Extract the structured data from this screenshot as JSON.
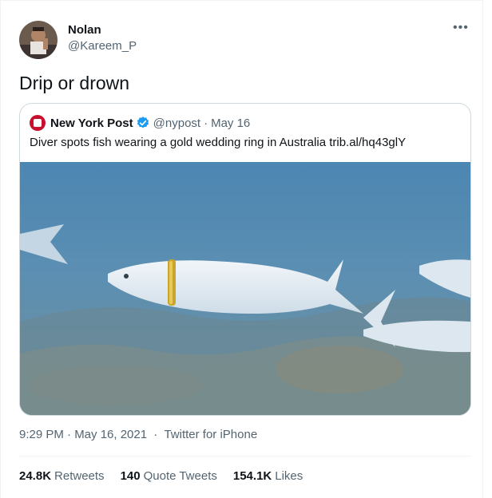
{
  "tweet": {
    "author_name": "Nolan",
    "author_handle": "@Kareem_P",
    "more_icon": "more-dots-icon",
    "text": "Drip or drown",
    "timestamp": "9:29 PM · May 16, 2021",
    "separator": "·",
    "source": "Twitter for iPhone"
  },
  "quoted": {
    "name": "New York Post",
    "handle": "@nypost",
    "dot": "·",
    "date": "May 16",
    "text": "Diver spots fish wearing a gold wedding ring in Australia trib.al/hq43glY",
    "verified_icon": "verified-badge-icon",
    "colors": {
      "logo": "#c8102e",
      "verified": "#1d9bf0"
    }
  },
  "stats": [
    {
      "count": "24.8K",
      "label": "Retweets"
    },
    {
      "count": "140",
      "label": "Quote Tweets"
    },
    {
      "count": "154.1K",
      "label": "Likes"
    }
  ],
  "colors": {
    "text": "#0f1419",
    "secondary": "#536471",
    "border": "#cfd9de"
  }
}
